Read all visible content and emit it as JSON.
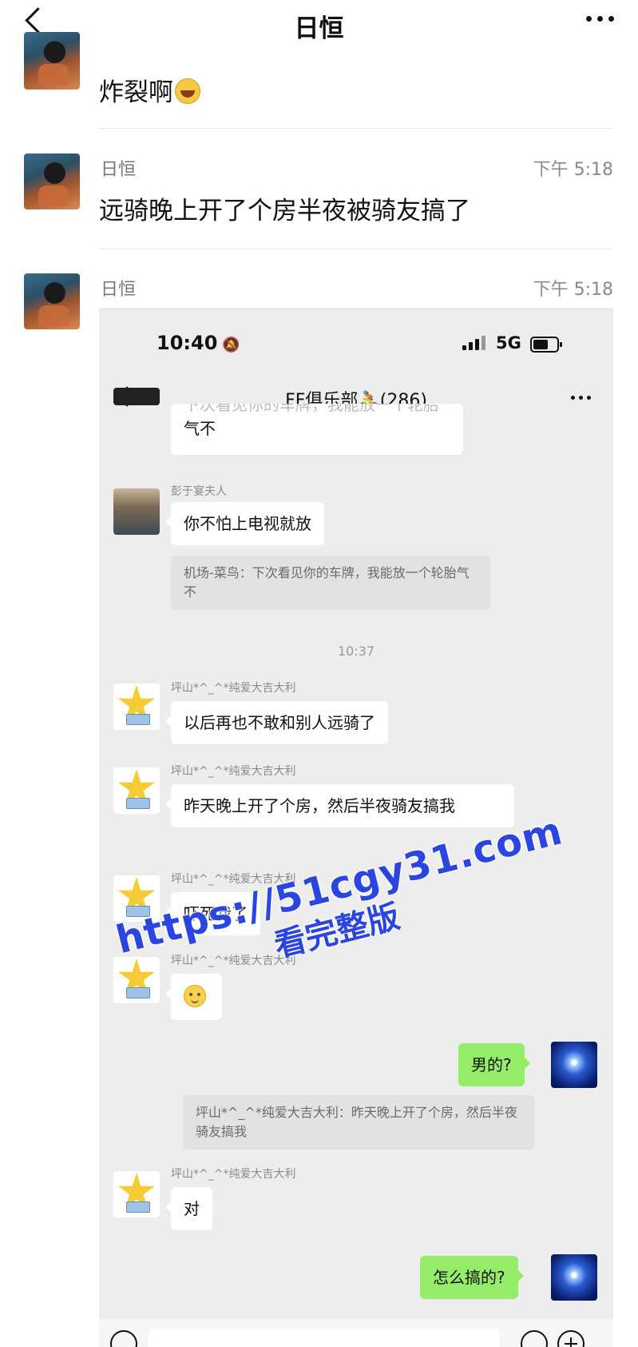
{
  "header": {
    "title": "日恒"
  },
  "outer_messages": [
    {
      "text": "炸裂啊"
    },
    {
      "sender": "日恒",
      "time": "下午 5:18",
      "text": "远骑晚上开了个房半夜被骑友搞了"
    },
    {
      "sender": "日恒",
      "time": "下午 5:18"
    }
  ],
  "screenshot": {
    "status": {
      "time": "10:40",
      "network": "5G"
    },
    "nav": {
      "title": "FF俱乐部🚴(286)"
    },
    "messages": [
      {
        "partial_text": "下次看见你的车牌，我能放一个轮胎",
        "text_tail": "气不"
      },
      {
        "sender": "彭于宴夫人",
        "text": "你不怕上电视就放",
        "quote": "机场-菜鸟：下次看见你的车牌，我能放一个轮胎气不"
      },
      {
        "timestamp": "10:37"
      },
      {
        "sender": "坪山*^_^*纯爱大吉大利",
        "text": "以后再也不敢和别人远骑了"
      },
      {
        "sender": "坪山*^_^*纯爱大吉大利",
        "text": "昨天晚上开了个房，然后半夜骑友搞我"
      },
      {
        "sender": "坪山*^_^*纯爱大吉大利",
        "text": "吓死我了"
      },
      {
        "sender": "坪山*^_^*纯爱大吉大利",
        "emoji": "grimace-emoji"
      },
      {
        "self": true,
        "text": "男的?",
        "quote": "坪山*^_^*纯爱大吉大利：昨天晚上开了个房，然后半夜骑友搞我"
      },
      {
        "sender": "坪山*^_^*纯爱大吉大利",
        "text": "对"
      },
      {
        "self": true,
        "text": "怎么搞的?"
      }
    ]
  },
  "watermark": {
    "line1": "https://51cgy31.com",
    "line2": "看完整版"
  },
  "icons": [
    "back-icon",
    "more-icon",
    "bell-off-icon",
    "signal-icon",
    "battery-icon",
    "voice-icon",
    "emoji-icon",
    "plus-icon",
    "laugh-emoji-icon"
  ]
}
